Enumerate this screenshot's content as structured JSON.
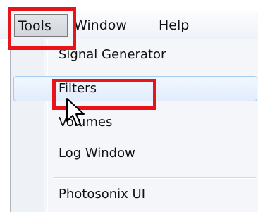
{
  "menubar": {
    "items": [
      {
        "label": "Tools"
      },
      {
        "label": "Window"
      },
      {
        "label": "Help"
      }
    ]
  },
  "tools_menu": {
    "items": [
      {
        "label": "Signal Generator",
        "state": "normal"
      },
      {
        "label": "Filters",
        "state": "hover"
      },
      {
        "label": "Volumes",
        "state": "normal"
      },
      {
        "label": "Log Window",
        "state": "normal"
      },
      {
        "label": "Photosonix UI",
        "state": "normal"
      }
    ]
  },
  "colors": {
    "highlight_box": "#e8141a",
    "hover_border": "#a8cbf0",
    "menu_background": "#f4f6fa"
  },
  "icons": {
    "cursor": "arrow-cursor-icon"
  }
}
